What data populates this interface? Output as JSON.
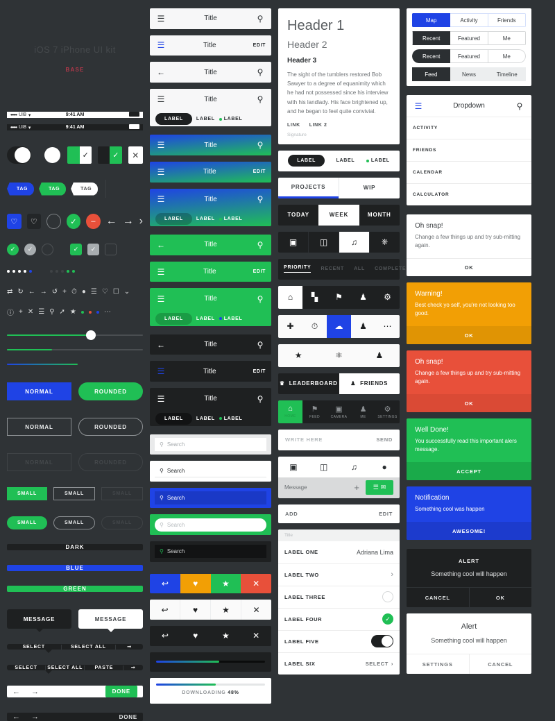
{
  "kit": {
    "title": "iOS 7 iPhone UI kit",
    "subtitle": "BASE"
  },
  "palette": {
    "dark": "#1e2021",
    "white": "#ffffff",
    "blue": "#1f43e5",
    "green": "#20bf55",
    "red": "#e8503a"
  },
  "statusbar": {
    "carrier": "UI8",
    "dots": "•••••",
    "time": "9:41 AM"
  },
  "tags": [
    "TAG",
    "TAG",
    "TAG"
  ],
  "buttons": {
    "normal": "NORMAL",
    "rounded": "ROUNDED",
    "small": "SMALL",
    "dark": "DARK",
    "blue": "BLUE",
    "green": "GREEN",
    "message": "MESSAGE",
    "select": "SELECT",
    "select_all": "SELECT ALL",
    "paste": "PASTE",
    "done": "DONE"
  },
  "navbars": {
    "title": "Title",
    "edit": "EDIT",
    "label": "LABEL"
  },
  "search": {
    "placeholder": "Search"
  },
  "progress": {
    "dark_percent": 48,
    "label_prefix": "DOWNLOADING",
    "label_percent": "48%"
  },
  "typography": {
    "h1": "Header 1",
    "h2": "Header 2",
    "h3": "Header 3",
    "body": "The sight of the tumblers restored Bob Sawyer to a degree of equanimity which he had not possessed since his interview with his landlady. His face brightened up, and he began to feel quite convivial.",
    "link1": "LINK",
    "link2": "LINK 2",
    "signature": "Signature"
  },
  "segmented": {
    "labels": [
      "LABEL",
      "LABEL",
      "LABEL"
    ],
    "projects": [
      "PROJECTS",
      "WIP"
    ],
    "period": [
      "TODAY",
      "WEEK",
      "MONTH"
    ],
    "filters": [
      "PRIORITY",
      "RECENT",
      "ALL",
      "COMPLETE"
    ],
    "map": [
      "Map",
      "Activity",
      "Friends"
    ],
    "recent": [
      "Recent",
      "Featured",
      "Me"
    ],
    "feed": [
      "Feed",
      "News",
      "Timeline"
    ]
  },
  "tabbar": {
    "social": [
      "LEADERBOARD",
      "FRIENDS"
    ],
    "labeled": [
      "HOME",
      "FEED",
      "CAMERA",
      "ME",
      "SETTINGS"
    ]
  },
  "composer": {
    "write_placeholder": "WRITE HERE",
    "send": "SEND",
    "message_placeholder": "Message",
    "add": "ADD",
    "edit": "EDIT"
  },
  "list": {
    "header": "Title",
    "rows": [
      {
        "label": "LABEL ONE",
        "value": "Adriana Lima"
      },
      {
        "label": "LABEL TWO",
        "value": ""
      },
      {
        "label": "LABEL THREE",
        "value": ""
      },
      {
        "label": "LABEL FOUR",
        "value": ""
      },
      {
        "label": "LABEL FIVE",
        "value": ""
      },
      {
        "label": "LABEL SIX",
        "value": "SELECT"
      }
    ]
  },
  "dropdown": {
    "title": "Dropdown",
    "items": [
      "ACTIVITY",
      "FRIENDS",
      "CALENDAR",
      "CALCULATOR"
    ]
  },
  "alerts": [
    {
      "title": "Oh snap!",
      "message": "Change a few things up and try sub-mitting again.",
      "action": "OK"
    },
    {
      "title": "Warning!",
      "message": "Best check yo self, you're not looking too good.",
      "action": "OK"
    },
    {
      "title": "Oh snap!",
      "message": "Change a few things up and try sub-mitting again.",
      "action": "OK"
    },
    {
      "title": "Well Done!",
      "message": "You successfully read this important alers message.",
      "action": "ACCEPT"
    },
    {
      "title": "Notification",
      "message": "Something cool was happen",
      "action": "AWESOME!"
    }
  ],
  "dialogs": [
    {
      "title": "ALERT",
      "message": "Something cool will happen",
      "left": "CANCEL",
      "right": "OK"
    },
    {
      "title": "Alert",
      "message": "Something cool will happen",
      "left": "SETTINGS",
      "right": "CANCEL"
    }
  ]
}
